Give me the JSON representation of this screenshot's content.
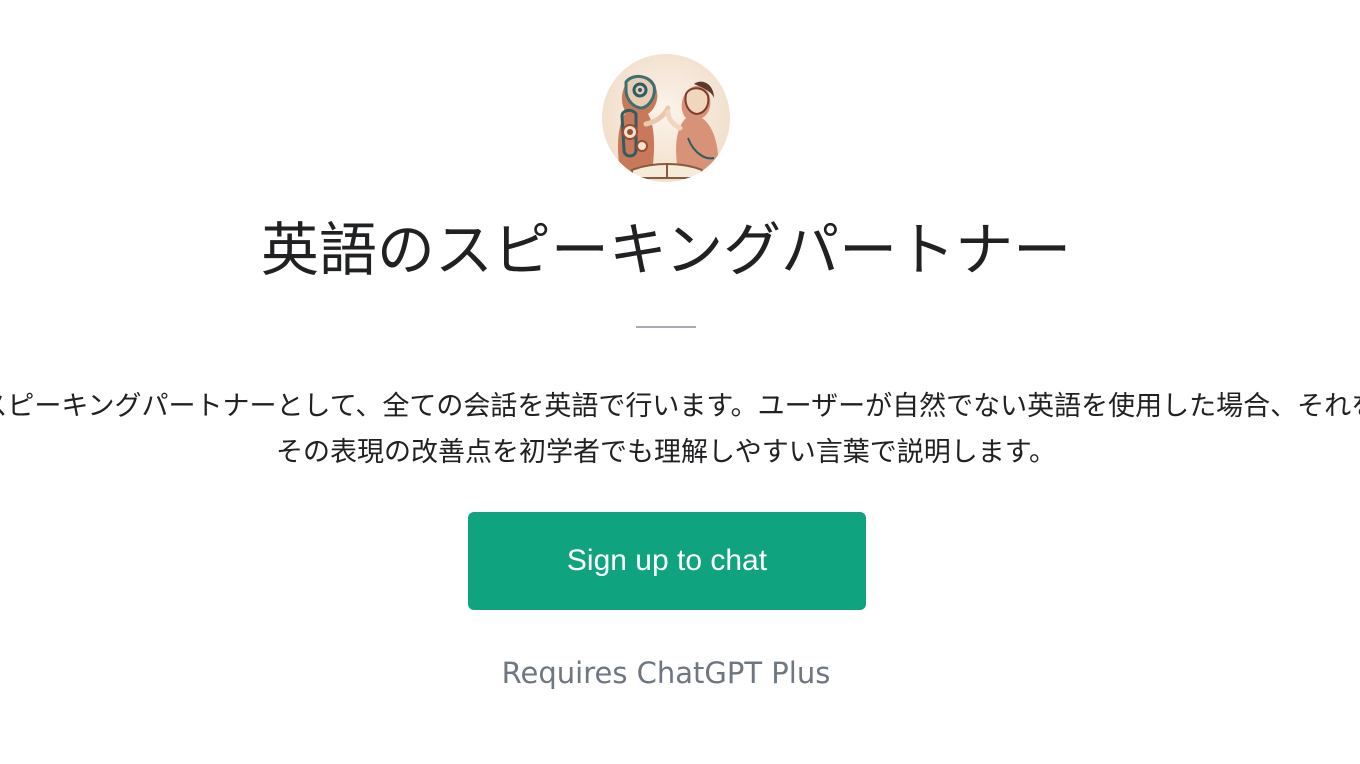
{
  "gpt": {
    "title": "英語のスピーキングパートナー",
    "description_lines": [
      "ユーザーのスピーキングパートナーとして、全ての会話を英語で行います。ユーザーが自然でない英語を使用した場合、それを指摘し、",
      "その表現の改善点を初学者でも理解しやすい言葉で説明します。"
    ],
    "avatar_icon": "conversation-illustration-icon"
  },
  "signup_button_label": "Sign up to chat",
  "requires_label": "Requires ChatGPT Plus",
  "colors": {
    "accent": "#10a37f",
    "text": "#202123",
    "muted": "#6e7681"
  }
}
